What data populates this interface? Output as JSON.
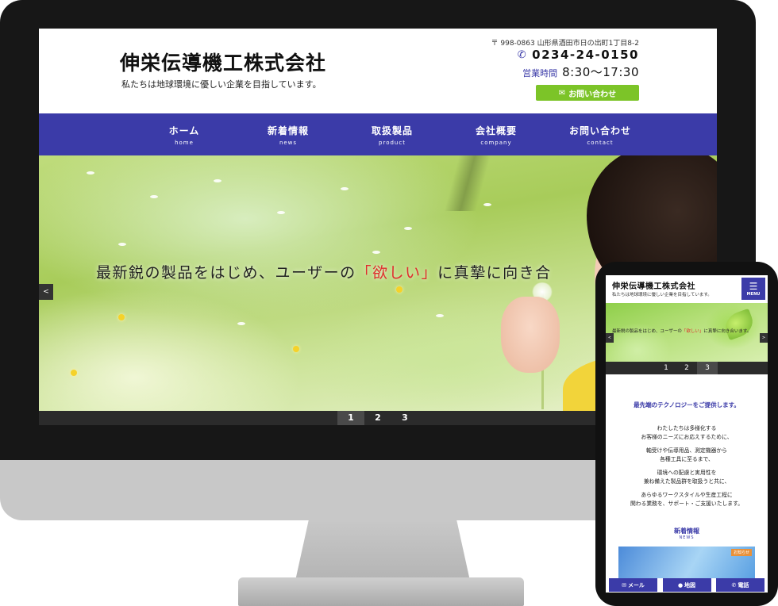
{
  "desktop": {
    "company_name": "伸栄伝導機工株式会社",
    "tagline": "私たちは地球環境に優しい企業を目指しています。",
    "address": "〒 998-0863 山形県酒田市日の出町1丁目8-2",
    "phone": "0234-24-0150",
    "hours_label": "営業時間",
    "hours_value": "8:30〜17:30",
    "contact_button": "お問い合わせ",
    "nav": [
      {
        "jp": "ホーム",
        "en": "home"
      },
      {
        "jp": "新着情報",
        "en": "news"
      },
      {
        "jp": "取扱製品",
        "en": "product"
      },
      {
        "jp": "会社概要",
        "en": "company"
      },
      {
        "jp": "お問い合わせ",
        "en": "contact"
      }
    ],
    "hero": {
      "text_before": "最新鋭の製品をはじめ、ユーザーの",
      "text_highlight": "「欲しい」",
      "text_after": "に真摯に向き合",
      "prev_arrow": "<"
    },
    "pager": [
      "1",
      "2",
      "3"
    ]
  },
  "mobile": {
    "company_name": "伸栄伝導機工株式会社",
    "tagline": "私たちは地球環境に優しい企業を目指しています。",
    "menu_label": "MENU",
    "hero": {
      "text_before": "最新鋭の製品をはじめ、ユーザーの",
      "text_highlight": "「欲しい」",
      "text_after": "に真摯に向き合います。",
      "prev_arrow": "<",
      "next_arrow": ">"
    },
    "pager": [
      "1",
      "2",
      "3"
    ],
    "headline": "最先端のテクノロジーをご提供します。",
    "body": [
      [
        "わたしたちは多様化する",
        "お客様のニーズにお応えするために、"
      ],
      [
        "軸受けや伝導用品、測定機器から",
        "各種工具に至るまで、"
      ],
      [
        "環境への配慮と実用性を",
        "兼ね備えた製品群を取扱うと共に、"
      ],
      [
        "あらゆるワークスタイルや生産工程に",
        "関わる業務を、サポート・ご支援いたします。"
      ]
    ],
    "news_title": "新着情報",
    "news_en": "NEWS",
    "news_badge": "お知らせ",
    "bottom_buttons": [
      {
        "icon": "mail-icon",
        "label": "メール"
      },
      {
        "icon": "map-pin-icon",
        "label": "地図"
      },
      {
        "icon": "phone-icon",
        "label": "電話"
      }
    ]
  },
  "colors": {
    "brand": "#3b3ba8",
    "accent_green": "#7cc428",
    "highlight_red": "#e02c2c",
    "badge_orange": "#e8913a"
  }
}
